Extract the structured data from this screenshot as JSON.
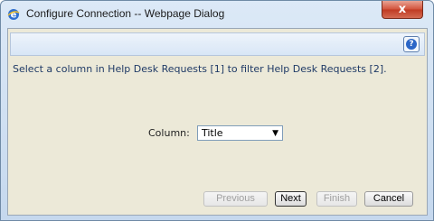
{
  "window": {
    "title": "Configure Connection -- Webpage Dialog",
    "close_label": "x",
    "help_label": "?"
  },
  "dialog": {
    "instruction": "Select a column in Help Desk Requests [1] to filter Help Desk Requests [2].",
    "column_label": "Column:",
    "column_value": "Title"
  },
  "buttons": {
    "previous": "Previous",
    "next": "Next",
    "finish": "Finish",
    "cancel": "Cancel"
  },
  "icons": {
    "app": "ie-icon",
    "help": "help-icon",
    "dropdown": "chevron-down-icon"
  }
}
